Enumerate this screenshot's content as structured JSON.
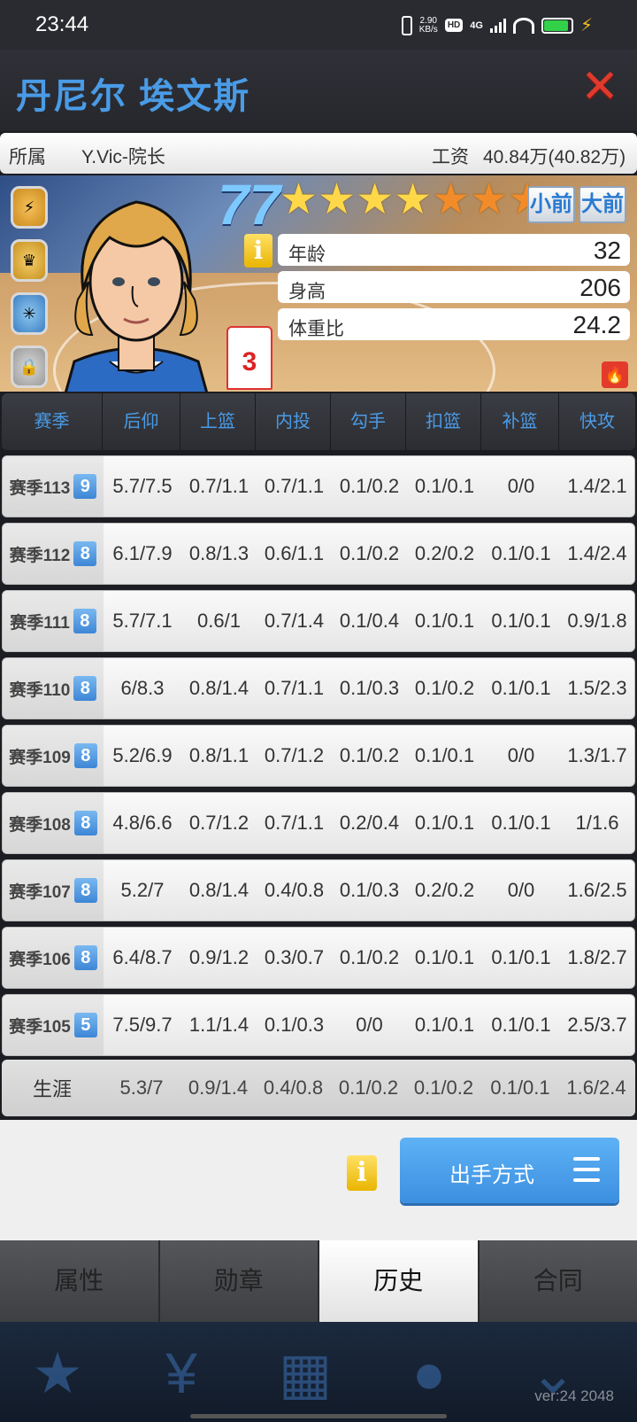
{
  "status_bar": {
    "time": "23:44",
    "net_speed_value": "2.90",
    "net_speed_unit": "KB/s",
    "hd": "HD",
    "network": "4G"
  },
  "header": {
    "player_name": "丹尼尔 埃文斯",
    "close_symbol": "✕"
  },
  "info_bar": {
    "team_label": "所属",
    "team_value": "Y.Vic-院长",
    "salary_label": "工资",
    "salary_value": "40.84万(40.82万)"
  },
  "profile": {
    "rating": "77",
    "stars_total": 7,
    "stars_gold": 4,
    "positions": [
      "小前",
      "大前"
    ],
    "info_icon": "i",
    "jersey_number": "3",
    "stats": [
      {
        "label": "年龄",
        "value": "32"
      },
      {
        "label": "身高",
        "value": "206"
      },
      {
        "label": "体重比",
        "value": "24.2"
      }
    ]
  },
  "table": {
    "columns": [
      "赛季",
      "后仰",
      "上篮",
      "内投",
      "勾手",
      "扣篮",
      "补篮",
      "快攻"
    ],
    "rows": [
      {
        "season": "赛季113",
        "level": "9",
        "cells": [
          "5.7/7.5",
          "0.7/1.1",
          "0.7/1.1",
          "0.1/0.2",
          "0.1/0.1",
          "0/0",
          "1.4/2.1"
        ]
      },
      {
        "season": "赛季112",
        "level": "8",
        "cells": [
          "6.1/7.9",
          "0.8/1.3",
          "0.6/1.1",
          "0.1/0.2",
          "0.2/0.2",
          "0.1/0.1",
          "1.4/2.4"
        ]
      },
      {
        "season": "赛季111",
        "level": "8",
        "cells": [
          "5.7/7.1",
          "0.6/1",
          "0.7/1.4",
          "0.1/0.4",
          "0.1/0.1",
          "0.1/0.1",
          "0.9/1.8"
        ]
      },
      {
        "season": "赛季110",
        "level": "8",
        "cells": [
          "6/8.3",
          "0.8/1.4",
          "0.7/1.1",
          "0.1/0.3",
          "0.1/0.2",
          "0.1/0.1",
          "1.5/2.3"
        ]
      },
      {
        "season": "赛季109",
        "level": "8",
        "cells": [
          "5.2/6.9",
          "0.8/1.1",
          "0.7/1.2",
          "0.1/0.2",
          "0.1/0.1",
          "0/0",
          "1.3/1.7"
        ]
      },
      {
        "season": "赛季108",
        "level": "8",
        "cells": [
          "4.8/6.6",
          "0.7/1.2",
          "0.7/1.1",
          "0.2/0.4",
          "0.1/0.1",
          "0.1/0.1",
          "1/1.6"
        ]
      },
      {
        "season": "赛季107",
        "level": "8",
        "cells": [
          "5.2/7",
          "0.8/1.4",
          "0.4/0.8",
          "0.1/0.3",
          "0.2/0.2",
          "0/0",
          "1.6/2.5"
        ]
      },
      {
        "season": "赛季106",
        "level": "8",
        "cells": [
          "6.4/8.7",
          "0.9/1.2",
          "0.3/0.7",
          "0.1/0.2",
          "0.1/0.1",
          "0.1/0.1",
          "1.8/2.7"
        ]
      },
      {
        "season": "赛季105",
        "level": "5",
        "cells": [
          "7.5/9.7",
          "1.1/1.4",
          "0.1/0.3",
          "0/0",
          "0.1/0.1",
          "0.1/0.1",
          "2.5/3.7"
        ]
      }
    ],
    "career": {
      "label": "生涯",
      "cells": [
        "5.3/7",
        "0.9/1.4",
        "0.4/0.8",
        "0.1/0.2",
        "0.1/0.2",
        "0.1/0.1",
        "1.6/2.4"
      ]
    }
  },
  "bottom": {
    "info_icon": "i",
    "shot_button_label": "出手方式"
  },
  "tabs": [
    {
      "label": "属性",
      "active": false
    },
    {
      "label": "勋章",
      "active": false
    },
    {
      "label": "历史",
      "active": true
    },
    {
      "label": "合同",
      "active": false
    }
  ],
  "footer": {
    "version": "ver:24  2048"
  },
  "colors": {
    "accent_blue": "#4a9be6",
    "close_red": "#e03a2c",
    "star_gold": "#ffd84a",
    "star_orange": "#f28b2a"
  }
}
